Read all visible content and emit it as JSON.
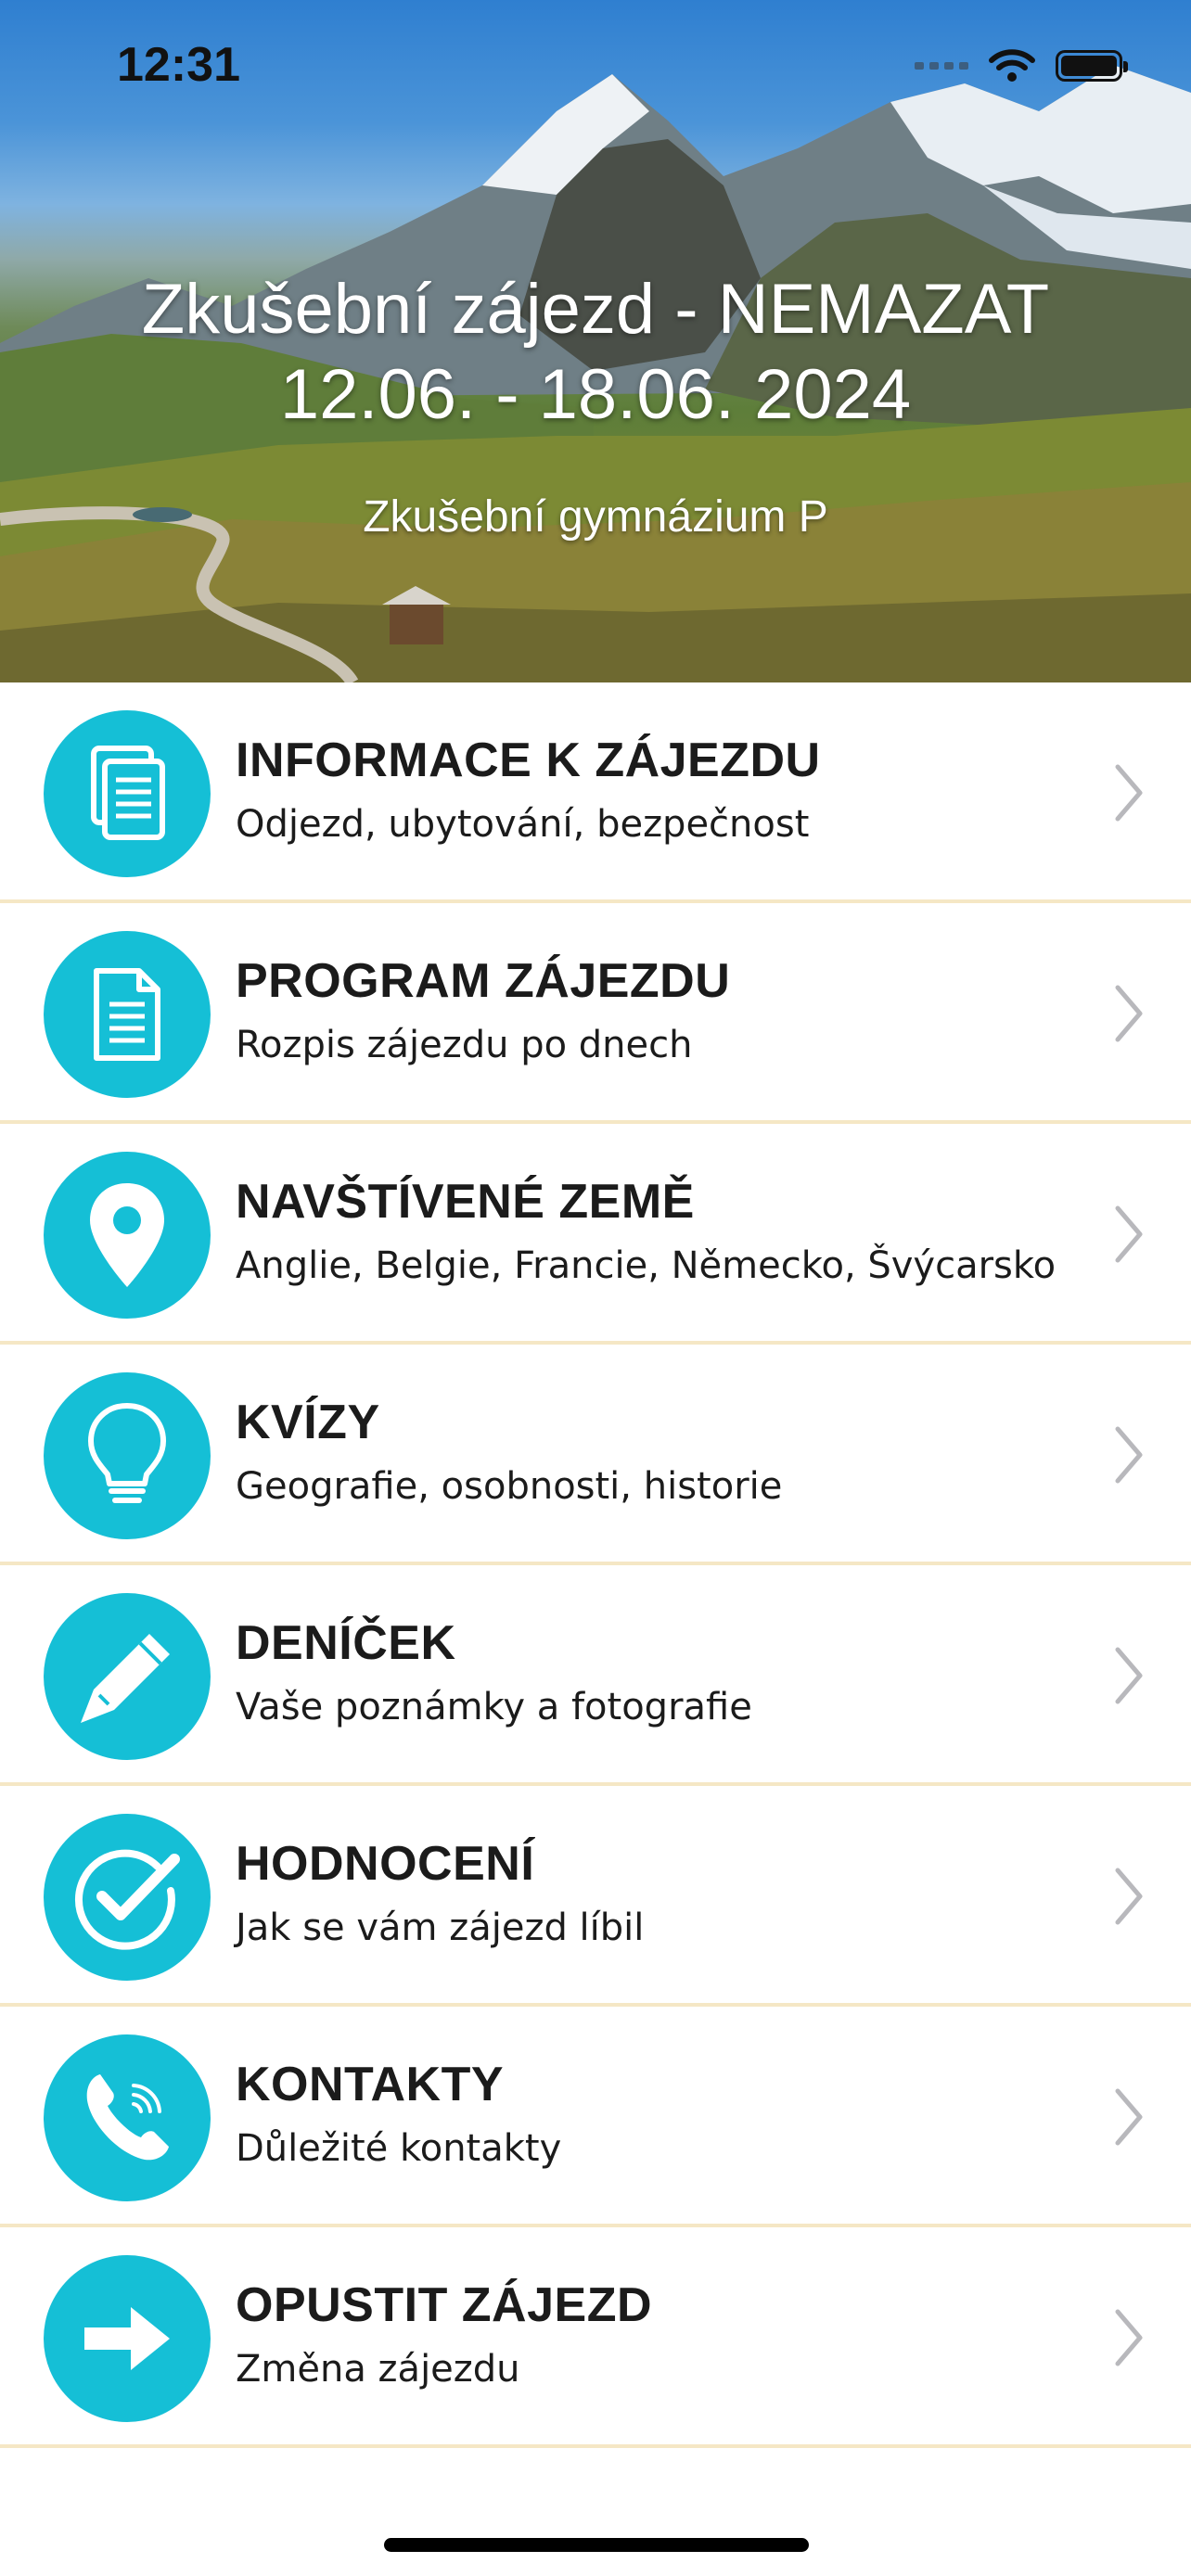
{
  "status_bar": {
    "time": "12:31"
  },
  "header": {
    "title_line1": "Zkušební zájezd - NEMAZAT",
    "title_line2": "12.06. - 18.06. 2024",
    "school": "Zkušební gymnázium P"
  },
  "theme": {
    "accent": "#15bfd6",
    "divider": "#f5e7c5",
    "chevron": "#b8b8bc"
  },
  "menu": [
    {
      "title": "INFORMACE K ZÁJEZDU",
      "subtitle": "Odjezd, ubytování, bezpečnost",
      "icon": "documents-icon"
    },
    {
      "title": "PROGRAM ZÁJEZDU",
      "subtitle": "Rozpis zájezdu po dnech",
      "icon": "document-icon"
    },
    {
      "title": "NAVŠTÍVENÉ ZEMĚ",
      "subtitle": "Anglie, Belgie, Francie, Německo, Švýcarsko",
      "icon": "map-pin-icon"
    },
    {
      "title": "KVÍZY",
      "subtitle": "Geografie, osobnosti, historie",
      "icon": "lightbulb-icon"
    },
    {
      "title": "DENÍČEK",
      "subtitle": "Vaše poznámky a fotografie",
      "icon": "pencil-icon"
    },
    {
      "title": "HODNOCENÍ",
      "subtitle": "Jak se vám zájezd líbil",
      "icon": "checkmark-icon"
    },
    {
      "title": "KONTAKTY",
      "subtitle": "Důležité kontakty",
      "icon": "phone-icon"
    },
    {
      "title": "OPUSTIT ZÁJEZD",
      "subtitle": "Změna zájezdu",
      "icon": "arrow-right-icon"
    }
  ]
}
